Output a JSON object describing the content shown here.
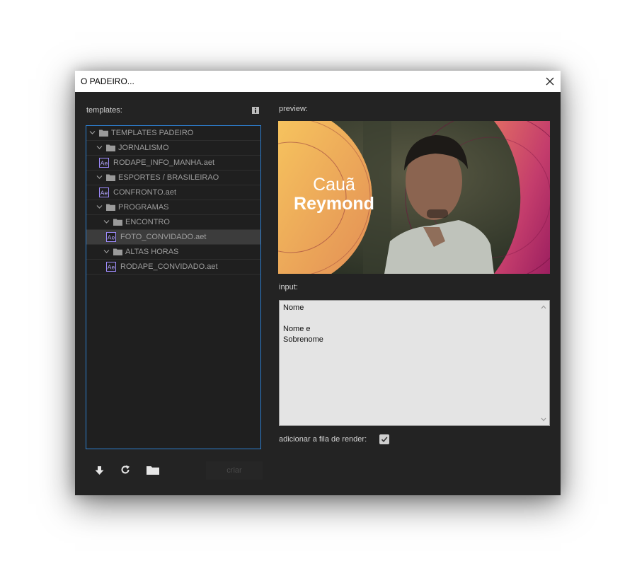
{
  "window": {
    "title": "O PADEIRO..."
  },
  "left": {
    "templates_label": "templates:",
    "tree": [
      {
        "label": "TEMPLATES PADEIRO",
        "type": "folder",
        "level": 0,
        "expanded": true
      },
      {
        "label": "JORNALISMO",
        "type": "folder",
        "level": 1,
        "expanded": true
      },
      {
        "label": "RODAPE_INFO_MANHA.aet",
        "type": "file",
        "level": 2
      },
      {
        "label": "ESPORTES / BRASILEIRAO",
        "type": "folder",
        "level": 1,
        "expanded": true
      },
      {
        "label": "CONFRONTO.aet",
        "type": "file",
        "level": 2
      },
      {
        "label": "PROGRAMAS",
        "type": "folder",
        "level": 1,
        "expanded": true
      },
      {
        "label": "ENCONTRO",
        "type": "folder",
        "level": 2,
        "expanded": true
      },
      {
        "label": "FOTO_CONVIDADO.aet",
        "type": "file",
        "level": 3,
        "selected": true
      },
      {
        "label": "ALTAS HORAS",
        "type": "folder",
        "level": 2,
        "expanded": true
      },
      {
        "label": "RODAPE_CONVIDADO.aet",
        "type": "file",
        "level": 3
      }
    ],
    "file_icon_text": "Ae",
    "create_label": "criar"
  },
  "right": {
    "preview_label": "preview:",
    "preview_overlay": {
      "first_name": "Cauã",
      "last_name": "Reymond"
    },
    "input_label": "input:",
    "input_lines": [
      "Nome",
      "",
      "Nome e",
      "Sobrenome"
    ],
    "render_queue_label": "adicionar a fila de render:",
    "render_queue_checked": true
  },
  "colors": {
    "accent": "#2d7fd0",
    "window_bg": "#232323",
    "ae_icon": "#9f8cff"
  }
}
